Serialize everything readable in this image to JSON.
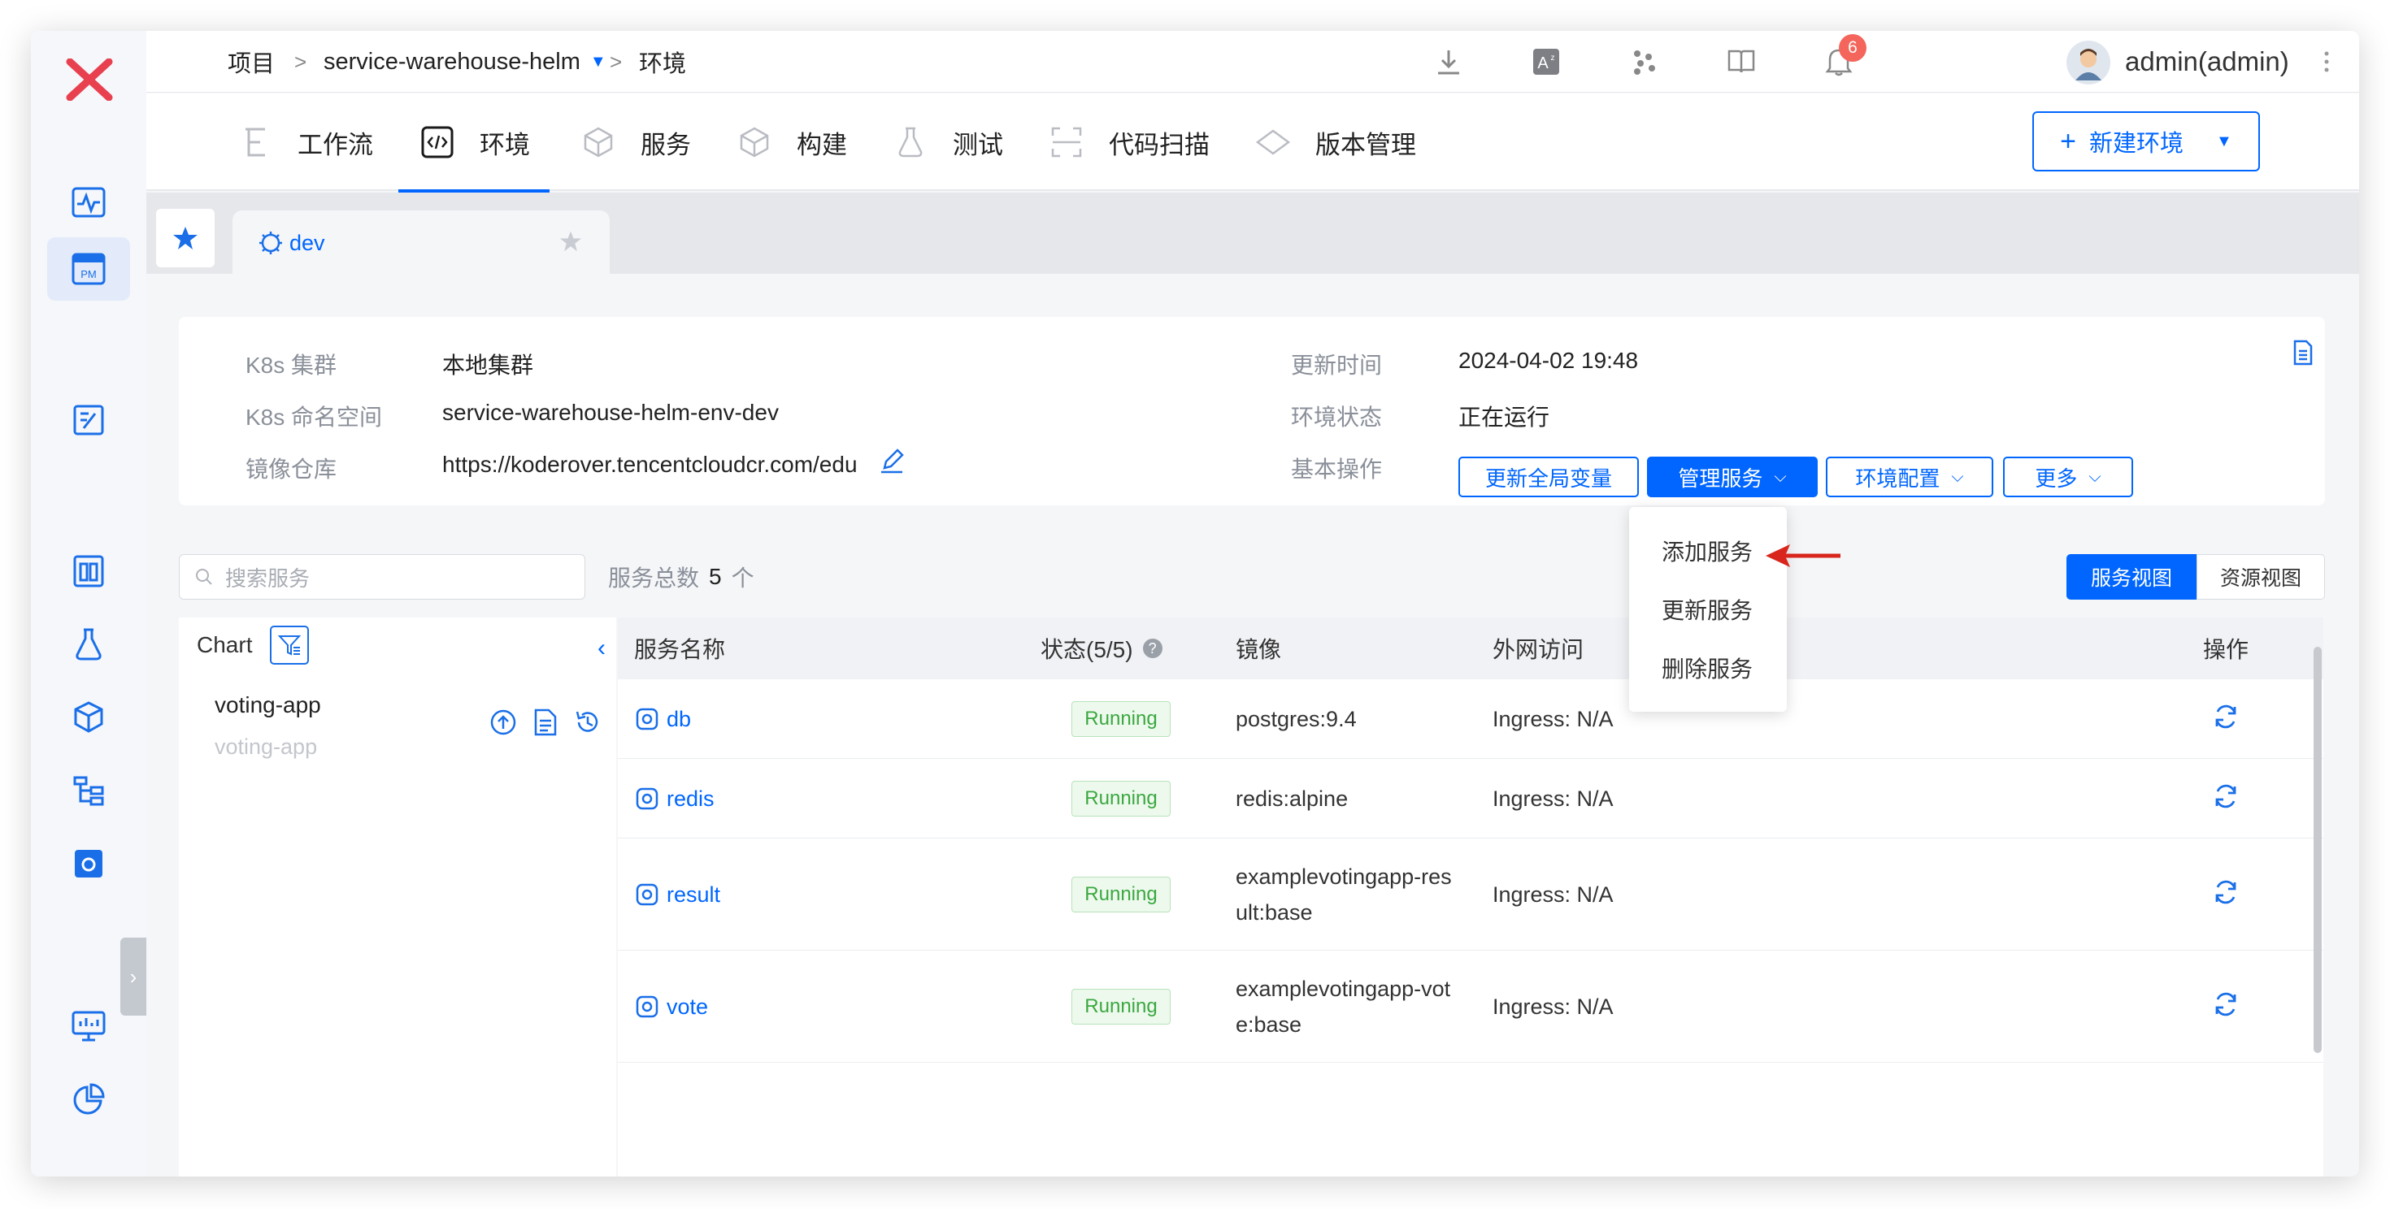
{
  "breadcrumb": {
    "root": "项目",
    "sep": ">",
    "project": "service-warehouse-helm",
    "current": "环境"
  },
  "header": {
    "notification_count": "6",
    "user": "admin(admin)"
  },
  "nav_tabs": [
    {
      "label": "工作流",
      "icon": "workflow-icon"
    },
    {
      "label": "环境",
      "icon": "code-icon"
    },
    {
      "label": "服务",
      "icon": "service-icon"
    },
    {
      "label": "构建",
      "icon": "build-icon"
    },
    {
      "label": "测试",
      "icon": "test-flask-icon"
    },
    {
      "label": "代码扫描",
      "icon": "scan-icon"
    },
    {
      "label": "版本管理",
      "icon": "version-icon"
    }
  ],
  "new_env_button": "新建环境",
  "env_tab": {
    "name": "dev"
  },
  "info": {
    "k8s_cluster_label": "K8s 集群",
    "k8s_cluster_value": "本地集群",
    "k8s_namespace_label": "K8s 命名空间",
    "k8s_namespace_value": "service-warehouse-helm-env-dev",
    "registry_label": "镜像仓库",
    "registry_value": "https://koderover.tencentcloudcr.com/edu",
    "update_time_label": "更新时间",
    "update_time_value": "2024-04-02 19:48",
    "env_status_label": "环境状态",
    "env_status_value": "正在运行",
    "basic_ops_label": "基本操作"
  },
  "ops": {
    "update_global_vars": "更新全局变量",
    "manage_services": "管理服务",
    "env_config": "环境配置",
    "more": "更多"
  },
  "manage_menu": [
    "添加服务",
    "更新服务",
    "删除服务"
  ],
  "search": {
    "placeholder": "搜索服务"
  },
  "stats": {
    "label": "服务总数",
    "count": "5",
    "unit": "个"
  },
  "views": {
    "service_view": "服务视图",
    "resource_view": "资源视图"
  },
  "chart_panel": {
    "title": "Chart",
    "chart_name": "voting-app",
    "chart_sub": "voting-app"
  },
  "table": {
    "headers": {
      "name": "服务名称",
      "status": "状态(5/5)",
      "image": "镜像",
      "access": "外网访问",
      "actions": "操作"
    },
    "rows": [
      {
        "name": "db",
        "status": "Running",
        "image": "postgres:9.4",
        "image2": "",
        "access": "Ingress: N/A"
      },
      {
        "name": "redis",
        "status": "Running",
        "image": "redis:alpine",
        "image2": "",
        "access": "Ingress: N/A"
      },
      {
        "name": "result",
        "status": "Running",
        "image": "examplevotingapp-res",
        "image2": "ult:base",
        "access": "Ingress: N/A"
      },
      {
        "name": "vote",
        "status": "Running",
        "image": "examplevotingapp-vot",
        "image2": "e:base",
        "access": "Ingress: N/A"
      }
    ]
  },
  "colors": {
    "primary": "#0066ff",
    "logo_red": "#e8404f",
    "running_green": "#3aa83f",
    "badge_red": "#f4655b",
    "arrow_red": "#d9261c"
  }
}
